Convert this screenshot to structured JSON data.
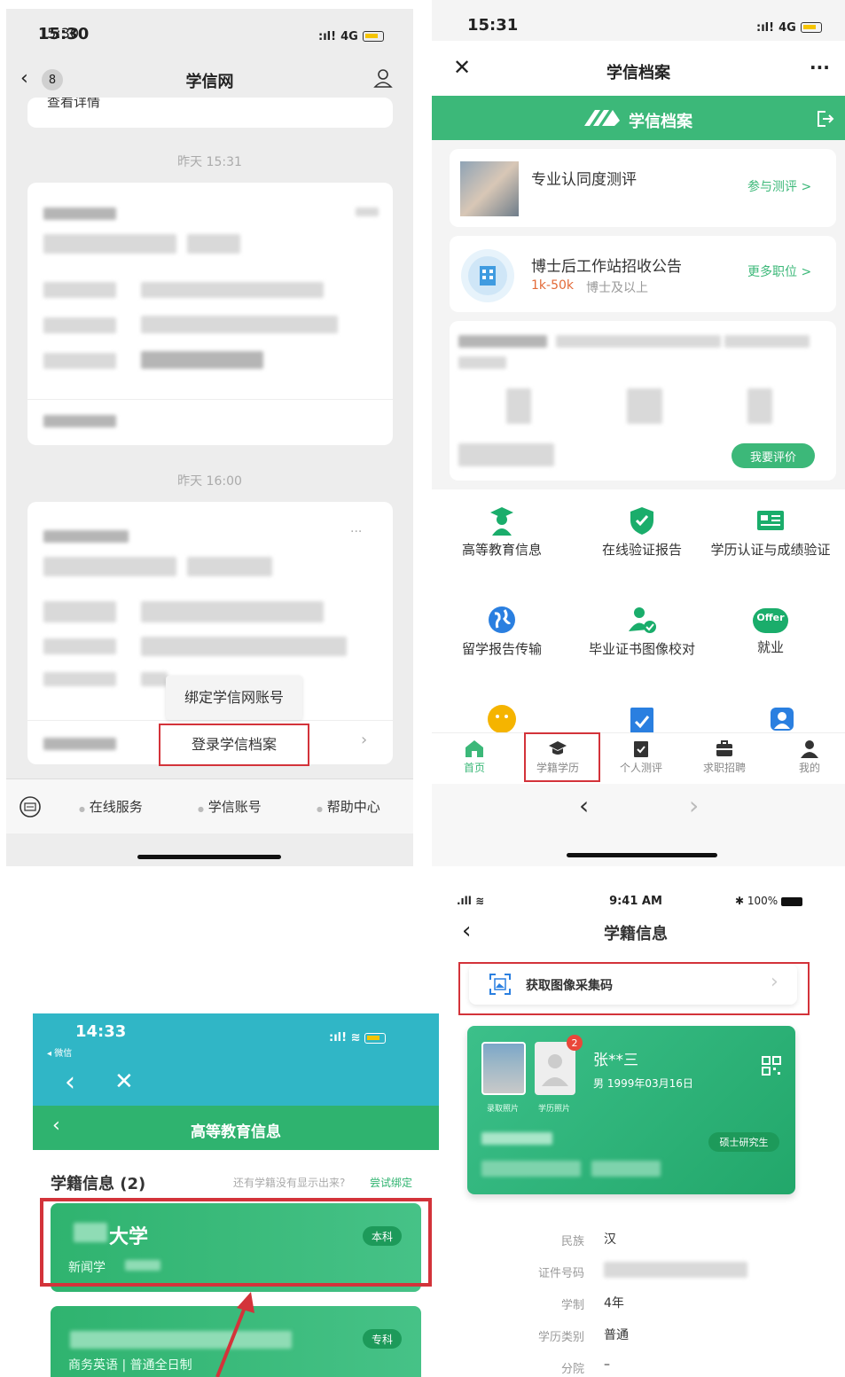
{
  "panel1": {
    "status": {
      "time": "15:30",
      "network": "4G"
    },
    "nav": {
      "back_badge": "8",
      "title": "学信网"
    },
    "cut_text": "查看详情",
    "timestamps": [
      "昨天 15:31",
      "昨天 16:00"
    ],
    "popup": {
      "bind_label": "绑定学信网账号",
      "login_label": "登录学信档案"
    },
    "menu": {
      "items": [
        "在线服务",
        "学信账号",
        "帮助中心"
      ]
    }
  },
  "panel2": {
    "status": {
      "time": "15:31",
      "network": "4G"
    },
    "nav": {
      "title": "学信档案",
      "more": "···"
    },
    "banner": {
      "brand": "学信档案"
    },
    "card_survey": {
      "title": "专业认同度测评",
      "action": "参与测评 >"
    },
    "card_postdoc": {
      "title": "博士后工作站招收公告",
      "salary": "1k-50k",
      "degree": "博士及以上",
      "action": "更多职位 >"
    },
    "rate_button": "我要评价",
    "grid": [
      {
        "label": "高等教育信息",
        "icon": "graduate-icon"
      },
      {
        "label": "在线验证报告",
        "icon": "shield-check-icon"
      },
      {
        "label": "学历认证与成绩验证",
        "icon": "id-card-icon"
      },
      {
        "label": "留学报告传输",
        "icon": "globe-icon"
      },
      {
        "label": "毕业证书图像校对",
        "icon": "user-check-icon"
      },
      {
        "label": "就业",
        "icon": "offer-icon"
      }
    ],
    "offer_text": "Offer",
    "tabs": [
      "首页",
      "学籍学历",
      "个人测评",
      "求职招聘",
      "我的"
    ],
    "colors": {
      "brand": "#3cb879",
      "accent": "#1aad6b",
      "highlight": "#d3333a"
    }
  },
  "panel3": {
    "status": {
      "time": "14:33",
      "back_app": "◂ 微信"
    },
    "header_title": "高等教育信息",
    "section_title": "学籍信息 (2)",
    "hint": "还有学籍没有显示出来?",
    "hint_link": "尝试绑定",
    "records": [
      {
        "name_suffix": "大学",
        "major": "新闻学",
        "level": "本科"
      },
      {
        "major": "商务英语 | 普通全日制",
        "level": "专科"
      }
    ]
  },
  "panel4": {
    "status": {
      "time": "9:41 AM",
      "battery": "100%"
    },
    "nav_title": "学籍信息",
    "capture_button": "获取图像采集码",
    "profile": {
      "name": "张**三",
      "gender_birth": "男   1999年03月16日",
      "photo_labels": [
        "录取照片",
        "学历照片"
      ],
      "badge": "2",
      "level": "硕士研究生"
    },
    "details": [
      {
        "label": "民族",
        "value": "汉"
      },
      {
        "label": "证件号码",
        "value": ""
      },
      {
        "label": "学制",
        "value": "4年"
      },
      {
        "label": "学历类别",
        "value": "普通"
      },
      {
        "label": "分院",
        "value": "–"
      }
    ]
  }
}
